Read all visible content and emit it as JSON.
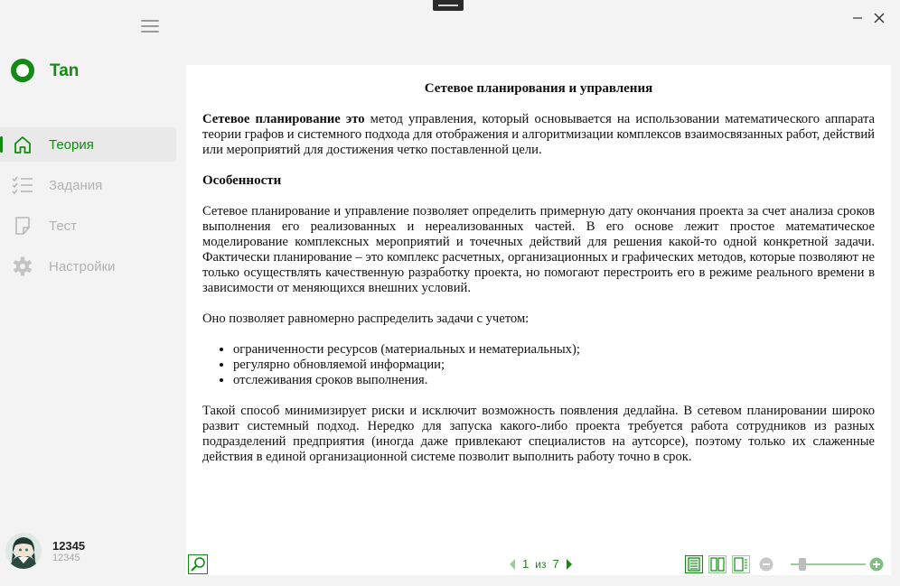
{
  "app": {
    "name": "Tan"
  },
  "nav": {
    "items": [
      {
        "label": "Теория",
        "icon": "home-icon",
        "active": true
      },
      {
        "label": "Задания",
        "icon": "checklist-icon",
        "active": false
      },
      {
        "label": "Тест",
        "icon": "note-icon",
        "active": false
      },
      {
        "label": "Настройки",
        "icon": "gear-icon",
        "active": false
      }
    ]
  },
  "user": {
    "name": "12345",
    "id": "12345"
  },
  "colors": {
    "accent": "#138a13",
    "inactive": "#b2b2b2",
    "sidebar_bg": "#f3f3f3"
  },
  "document": {
    "title": "Сетевое планирования и управления",
    "intro_bold": "Сетевое планирование это",
    "intro_rest": " метод управления, который основывается на использовании математического аппарата теории графов и системного подхода для отображения и алгоритмизации комплексов взаимосвязанных работ, действий или мероприятий для достижения четко поставленной цели.",
    "heading": "Особенности",
    "paragraph1": "Сетевое планирование и управление позволяет определить примерную дату окончания проекта за счет анализа сроков выполнения его реализованных и нереализованных частей. В его основе лежит простое математическое моделирование комплексных мероприятий и точечных действий для решения какой-то одной конкретной задачи. Фактически планирование – это комплекс расчетных, организационных и графических методов, которые позволяют не только осуществлять качественную разработку проекта, но помогают перестроить его в режиме реального времени в зависимости от меняющихся внешних условий.",
    "paragraph2": "Оно позволяет равномерно распределить задачи с учетом:",
    "bullets": [
      "ограниченности ресурсов (материальных и нематериальных);",
      "регулярно обновляемой информации;",
      "отслеживания сроков выполнения."
    ],
    "paragraph3": "Такой способ минимизирует риски и исключит возможность появления дедлайна. В сетевом планировании широко развит системный подход. Нередко для запуска какого-либо проекта требуется работа сотрудников из разных подразделений предприятия (иногда даже привлекают специалистов на аутсорсе), поэтому только их слаженные действия в единой организационной системе позволит выполнить работу точно в срок."
  },
  "pager": {
    "current": "1",
    "of_label": "из",
    "total": "7"
  },
  "zoom": {
    "level": 0.12
  }
}
